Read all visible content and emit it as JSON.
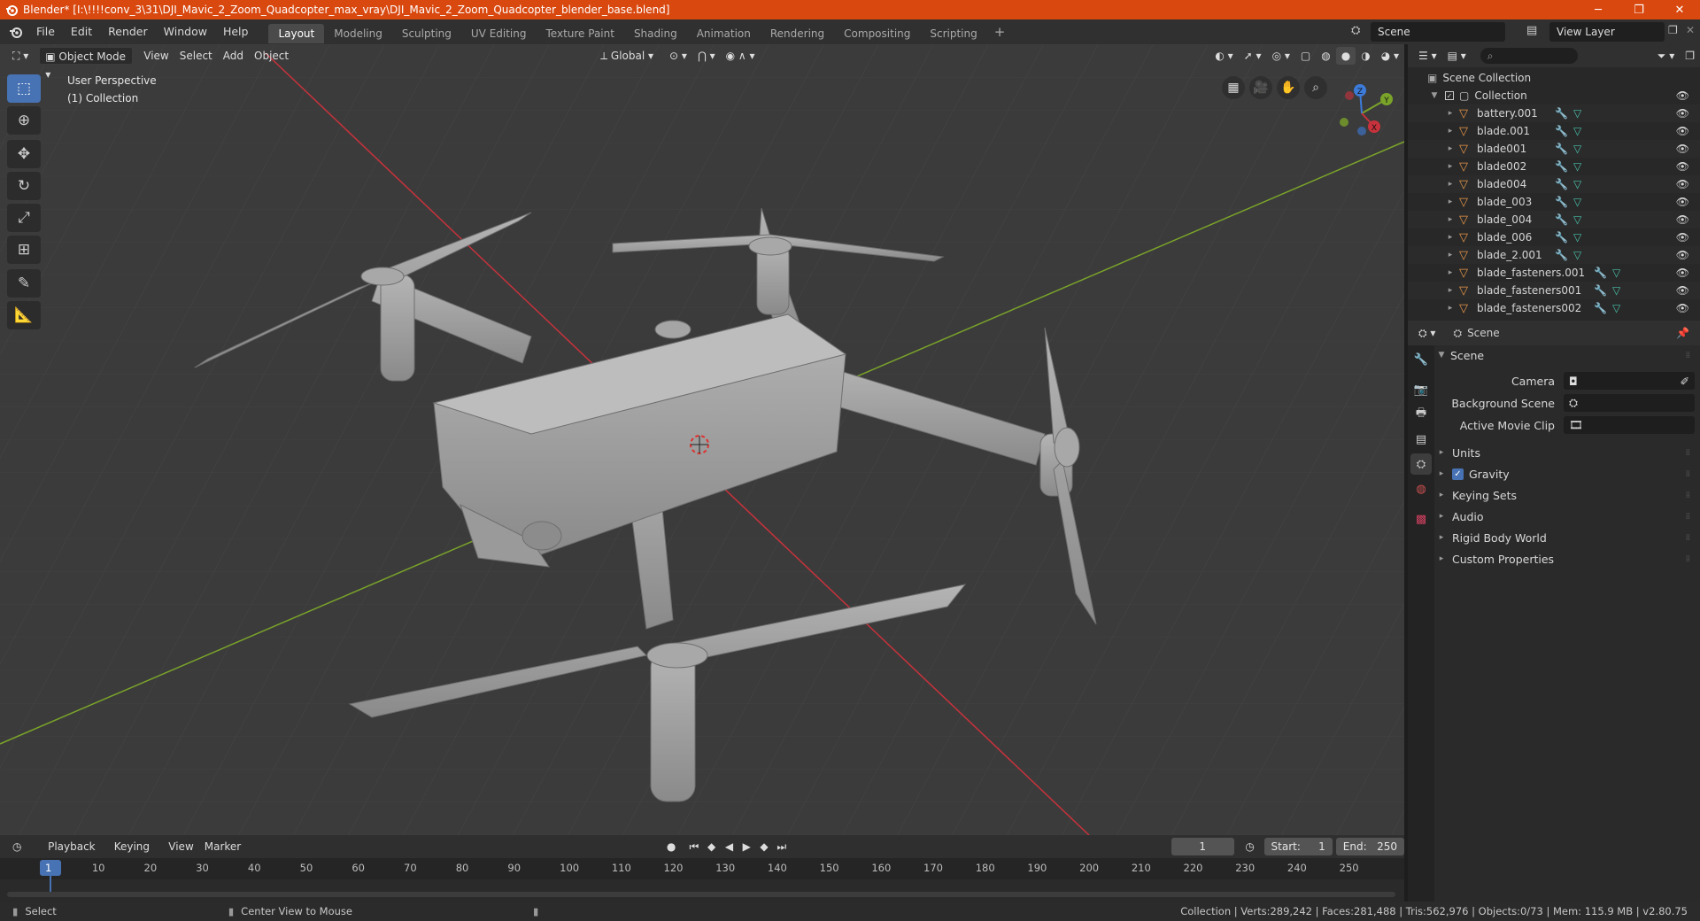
{
  "titlebar": {
    "text": "Blender* [I:\\!!!!conv_3\\31\\DJI_Mavic_2_Zoom_Quadcopter_max_vray\\DJI_Mavic_2_Zoom_Quadcopter_blender_base.blend]",
    "minimize": "─",
    "maximize": "❐",
    "close": "✕"
  },
  "menu": {
    "items": [
      "File",
      "Edit",
      "Render",
      "Window",
      "Help"
    ],
    "workspaces": [
      "Layout",
      "Modeling",
      "Sculpting",
      "UV Editing",
      "Texture Paint",
      "Shading",
      "Animation",
      "Rendering",
      "Compositing",
      "Scripting"
    ],
    "active_workspace": "Layout",
    "add_workspace": "+",
    "scene": "Scene",
    "view_layer": "View Layer"
  },
  "viewport": {
    "mode": "Object Mode",
    "menus": [
      "View",
      "Select",
      "Add",
      "Object"
    ],
    "orientation": "Global",
    "perspective_label": "User Perspective",
    "collection_label": "(1) Collection",
    "gizmo_axes": {
      "x": "X",
      "y": "Y",
      "z": "Z"
    },
    "colors": {
      "x_axis": "#c8323c",
      "y_axis": "#7aa32a",
      "z_axis": "#3d7bd9",
      "bg": "#3b3b3b"
    }
  },
  "toolbar": {
    "tools": [
      "select-box",
      "cursor",
      "move",
      "rotate",
      "scale",
      "transform",
      "annotate",
      "measure"
    ]
  },
  "outliner": {
    "root": "Scene Collection",
    "collection": "Collection",
    "objects": [
      "battery.001",
      "blade.001",
      "blade001",
      "blade002",
      "blade004",
      "blade_003",
      "blade_004",
      "blade_006",
      "blade_2.001",
      "blade_fasteners.001",
      "blade_fasteners001",
      "blade_fasteners002"
    ]
  },
  "properties": {
    "context": "Scene",
    "panel_title": "Scene",
    "fields": [
      {
        "label": "Camera",
        "value": ""
      },
      {
        "label": "Background Scene",
        "value": ""
      },
      {
        "label": "Active Movie Clip",
        "value": ""
      }
    ],
    "sections": [
      "Units",
      "Gravity",
      "Keying Sets",
      "Audio",
      "Rigid Body World",
      "Custom Properties"
    ],
    "gravity_checked": true
  },
  "timeline": {
    "menus": [
      "Playback",
      "Keying",
      "View",
      "Marker"
    ],
    "current_frame": "1",
    "start_label": "Start:",
    "start": "1",
    "end_label": "End:",
    "end": "250",
    "ticks": [
      "1",
      "10",
      "20",
      "30",
      "40",
      "50",
      "60",
      "70",
      "80",
      "90",
      "100",
      "110",
      "120",
      "130",
      "140",
      "150",
      "160",
      "170",
      "180",
      "190",
      "200",
      "210",
      "220",
      "230",
      "240",
      "250"
    ]
  },
  "statusbar": {
    "left": "Select",
    "middle": "Center View to Mouse",
    "right": "Collection | Verts:289,242 | Faces:281,488 | Tris:562,976 | Objects:0/73 | Mem: 115.9 MB | v2.80.75"
  }
}
